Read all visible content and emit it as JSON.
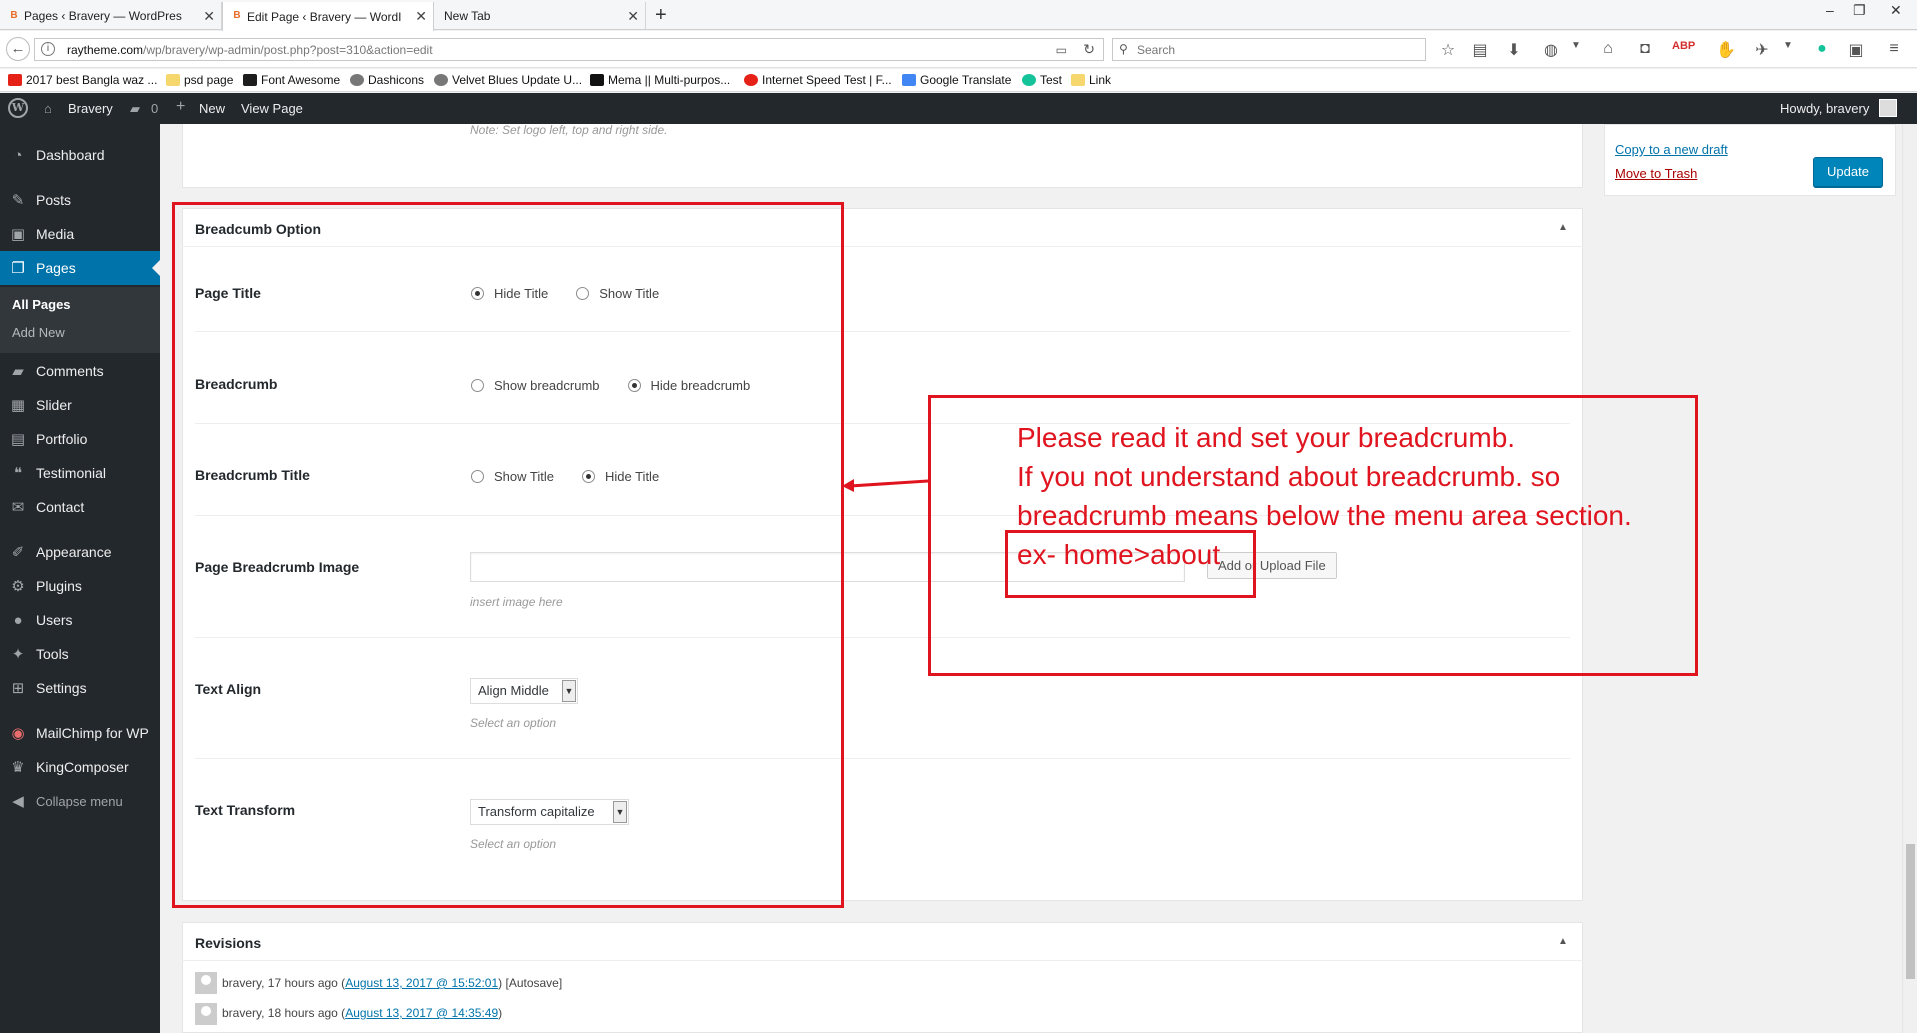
{
  "browser": {
    "tabs": [
      {
        "label": "Pages ‹ Bravery — WordPres",
        "favicon": "B",
        "active": false
      },
      {
        "label": "Edit Page ‹ Bravery — WordI",
        "favicon": "B",
        "active": true
      },
      {
        "label": "New Tab",
        "favicon": "",
        "active": false
      }
    ],
    "url_host": "raytheme.com",
    "url_path": "/wp/bravery/wp-admin/post.php?post=310&action=edit",
    "search_placeholder": "Search",
    "bookmarks": [
      {
        "label": "2017 best Bangla waz ...",
        "color": "#e62117"
      },
      {
        "label": "psd page",
        "color": "#f5d76e"
      },
      {
        "label": "Font Awesome",
        "color": "#1d1d1d"
      },
      {
        "label": "Dashicons",
        "color": "#777777"
      },
      {
        "label": "Velvet Blues Update U...",
        "color": "#777777"
      },
      {
        "label": "Mema || Multi-purpos...",
        "color": "#111111"
      },
      {
        "label": "Internet Speed Test | F...",
        "color": "#e62117"
      },
      {
        "label": "Google Translate",
        "color": "#4285f4"
      },
      {
        "label": "Test",
        "color": "#15c39a"
      },
      {
        "label": "Link",
        "color": "#f5d76e"
      }
    ]
  },
  "adminbar": {
    "site_name": "Bravery",
    "comments_count": "0",
    "new_label": "New",
    "view_page_label": "View Page",
    "howdy": "Howdy, bravery"
  },
  "sidebar": {
    "items": [
      {
        "label": "Dashboard",
        "icon": "dashboard-icon"
      },
      {
        "label": "Posts",
        "icon": "pin-icon"
      },
      {
        "label": "Media",
        "icon": "media-icon"
      },
      {
        "label": "Pages",
        "icon": "pages-icon",
        "current": true
      },
      {
        "label": "Comments",
        "icon": "comments-icon"
      },
      {
        "label": "Slider",
        "icon": "slider-icon"
      },
      {
        "label": "Portfolio",
        "icon": "portfolio-icon"
      },
      {
        "label": "Testimonial",
        "icon": "testimonial-icon"
      },
      {
        "label": "Contact",
        "icon": "mail-icon"
      },
      {
        "label": "Appearance",
        "icon": "brush-icon"
      },
      {
        "label": "Plugins",
        "icon": "plugin-icon"
      },
      {
        "label": "Users",
        "icon": "user-icon"
      },
      {
        "label": "Tools",
        "icon": "wrench-icon"
      },
      {
        "label": "Settings",
        "icon": "settings-icon"
      },
      {
        "label": "MailChimp for WP",
        "icon": "mailchimp-icon"
      },
      {
        "label": "KingComposer",
        "icon": "crown-icon"
      }
    ],
    "submenu": {
      "all_pages": "All Pages",
      "add_new": "Add New"
    },
    "collapse_label": "Collapse menu"
  },
  "content": {
    "top_note": "Note: Set logo left, top and right side.",
    "breadcrumb_box": {
      "title": "Breadcumb Option",
      "page_title": {
        "label": "Page Title",
        "options": [
          "Hide Title",
          "Show Title"
        ],
        "selected": "Hide Title"
      },
      "breadcrumb": {
        "label": "Breadcrumb",
        "options": [
          "Show breadcrumb",
          "Hide breadcrumb"
        ],
        "selected": "Hide breadcrumb"
      },
      "breadcrumb_title": {
        "label": "Breadcrumb Title",
        "options": [
          "Show Title",
          "Hide Title"
        ],
        "selected": "Hide Title"
      },
      "image": {
        "label": "Page Breadcrumb Image",
        "value": "",
        "button": "Add or Upload File",
        "help": "insert image here"
      },
      "text_align": {
        "label": "Text Align",
        "value": "Align Middle",
        "help": "Select an option"
      },
      "text_transform": {
        "label": "Text Transform",
        "value": "Transform capitalize",
        "help": "Select an option"
      }
    },
    "revisions": {
      "title": "Revisions",
      "items": [
        {
          "author": "bravery, 17 hours ago (",
          "link": "August 13, 2017 @ 15:52:01",
          "suffix": ") [Autosave]"
        },
        {
          "author": "bravery, 18 hours ago (",
          "link": "August 13, 2017 @ 14:35:49",
          "suffix": ")"
        }
      ]
    },
    "publish": {
      "copy_draft": "Copy to a new draft",
      "trash": "Move to Trash",
      "update": "Update"
    }
  },
  "annotation": {
    "lines": [
      "Please read it and set your breadcrumb.",
      "If you not understand about breadcrumb. so",
      "breadcrumb means below the menu area section.",
      "ex- home>about"
    ],
    "color": "#e0141e"
  }
}
